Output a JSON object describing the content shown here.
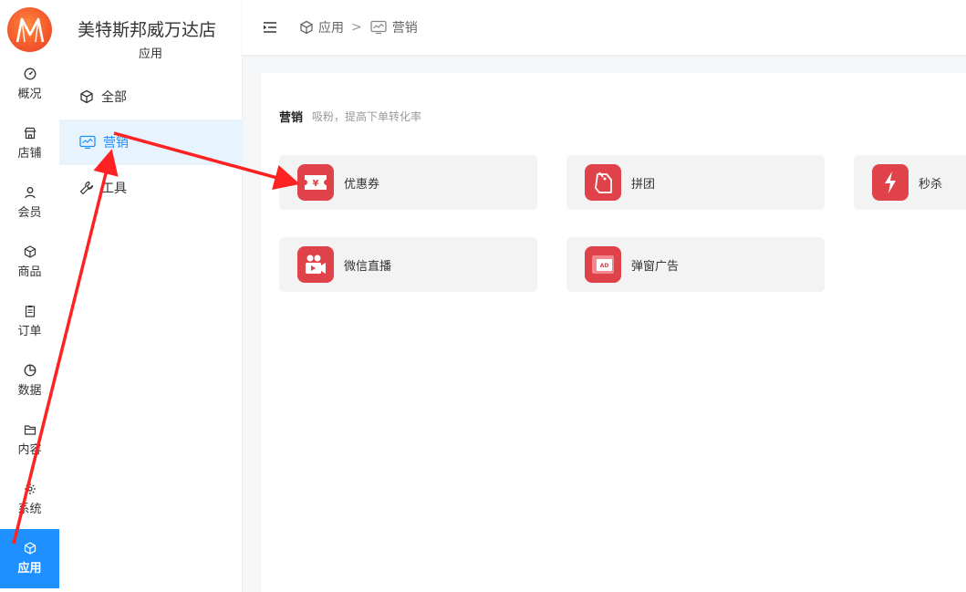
{
  "store": {
    "name": "美特斯邦威万达店",
    "section": "应用"
  },
  "rail": [
    {
      "label": "概况",
      "icon": "dashboard-icon"
    },
    {
      "label": "店铺",
      "icon": "store-icon"
    },
    {
      "label": "会员",
      "icon": "user-icon"
    },
    {
      "label": "商品",
      "icon": "box-icon"
    },
    {
      "label": "订单",
      "icon": "clipboard-icon"
    },
    {
      "label": "数据",
      "icon": "pie-chart-icon"
    },
    {
      "label": "内容",
      "icon": "folder-icon"
    },
    {
      "label": "系统",
      "icon": "gear-icon"
    },
    {
      "label": "应用",
      "icon": "cube-icon",
      "active": true
    }
  ],
  "subnav": [
    {
      "label": "全部",
      "icon": "cube-icon"
    },
    {
      "label": "营销",
      "icon": "trend-monitor-icon",
      "active": true
    },
    {
      "label": "工具",
      "icon": "wrench-icon"
    }
  ],
  "breadcrumb": {
    "first": "应用",
    "separator": ">",
    "second": "营销"
  },
  "section": {
    "title": "营销",
    "desc": "吸粉，提高下单转化率"
  },
  "cards": [
    {
      "label": "优惠券",
      "icon": "coupon-icon"
    },
    {
      "label": "拼团",
      "icon": "group-buy-icon"
    },
    {
      "label": "秒杀",
      "icon": "lightning-icon"
    },
    {
      "label": "微信直播",
      "icon": "live-video-icon"
    },
    {
      "label": "弹窗广告",
      "icon": "popup-ad-icon"
    }
  ],
  "colors": {
    "accent": "#1e90ff",
    "card_icon": "#e0424a",
    "annotation": "#ff2222"
  }
}
